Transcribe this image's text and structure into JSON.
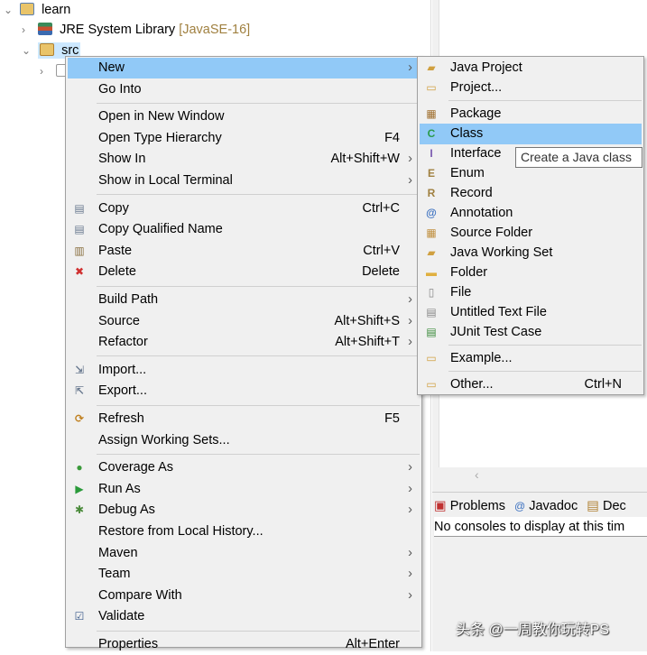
{
  "tree": {
    "project": "learn",
    "jre": "JRE System Library",
    "jre_version": "[JavaSE-16]",
    "src": "src"
  },
  "context_menu": {
    "items": [
      {
        "label": "New",
        "submenu": true,
        "highlighted": true
      },
      {
        "label": "Go Into"
      },
      {
        "sep": true
      },
      {
        "label": "Open in New Window"
      },
      {
        "label": "Open Type Hierarchy",
        "accel": "F4"
      },
      {
        "label": "Show In",
        "accel": "Alt+Shift+W",
        "submenu": true
      },
      {
        "label": "Show in Local Terminal",
        "submenu": true
      },
      {
        "sep": true
      },
      {
        "label": "Copy",
        "accel": "Ctrl+C",
        "icon": "copy-icon"
      },
      {
        "label": "Copy Qualified Name",
        "icon": "copy-qualified-icon"
      },
      {
        "label": "Paste",
        "accel": "Ctrl+V",
        "icon": "paste-icon"
      },
      {
        "label": "Delete",
        "accel": "Delete",
        "icon": "delete-icon"
      },
      {
        "sep": true
      },
      {
        "label": "Build Path",
        "submenu": true
      },
      {
        "label": "Source",
        "accel": "Alt+Shift+S",
        "submenu": true
      },
      {
        "label": "Refactor",
        "accel": "Alt+Shift+T",
        "submenu": true
      },
      {
        "sep": true
      },
      {
        "label": "Import...",
        "icon": "import-icon"
      },
      {
        "label": "Export...",
        "icon": "export-icon"
      },
      {
        "sep": true
      },
      {
        "label": "Refresh",
        "accel": "F5",
        "icon": "refresh-icon"
      },
      {
        "label": "Assign Working Sets..."
      },
      {
        "sep": true
      },
      {
        "label": "Coverage As",
        "submenu": true,
        "icon": "coverage-icon"
      },
      {
        "label": "Run As",
        "submenu": true,
        "icon": "run-icon"
      },
      {
        "label": "Debug As",
        "submenu": true,
        "icon": "debug-icon"
      },
      {
        "label": "Restore from Local History..."
      },
      {
        "label": "Maven",
        "submenu": true
      },
      {
        "label": "Team",
        "submenu": true
      },
      {
        "label": "Compare With",
        "submenu": true
      },
      {
        "label": "Validate",
        "icon": "checkbox-icon"
      },
      {
        "sep": true
      },
      {
        "label": "Properties",
        "accel": "Alt+Enter"
      }
    ]
  },
  "new_submenu": {
    "items": [
      {
        "label": "Java Project",
        "icon": "java-project-icon"
      },
      {
        "label": "Project...",
        "icon": "project-icon"
      },
      {
        "sep": true
      },
      {
        "label": "Package",
        "icon": "package-icon"
      },
      {
        "label": "Class",
        "icon": "class-icon",
        "highlighted": true
      },
      {
        "label": "Interface",
        "icon": "interface-icon"
      },
      {
        "label": "Enum",
        "icon": "enum-icon"
      },
      {
        "label": "Record",
        "icon": "record-icon"
      },
      {
        "label": "Annotation",
        "icon": "annotation-icon"
      },
      {
        "label": "Source Folder",
        "icon": "source-folder-icon"
      },
      {
        "label": "Java Working Set",
        "icon": "working-set-icon"
      },
      {
        "label": "Folder",
        "icon": "folder-icon"
      },
      {
        "label": "File",
        "icon": "file-icon"
      },
      {
        "label": "Untitled Text File",
        "icon": "text-file-icon"
      },
      {
        "label": "JUnit Test Case",
        "icon": "junit-icon"
      },
      {
        "sep": true
      },
      {
        "label": "Example...",
        "icon": "example-icon"
      },
      {
        "sep": true
      },
      {
        "label": "Other...",
        "accel": "Ctrl+N",
        "icon": "other-icon"
      }
    ]
  },
  "tooltip": "Create a Java class",
  "bottom_panel": {
    "tabs": [
      "Problems",
      "Javadoc",
      "Dec"
    ],
    "console_message": "No consoles to display at this tim"
  },
  "watermark": "头条 @一周教你玩转PS",
  "colors": {
    "highlight": "#91c9f7",
    "menu_bg": "#f0f0f0",
    "jre_version": "#a08040"
  }
}
